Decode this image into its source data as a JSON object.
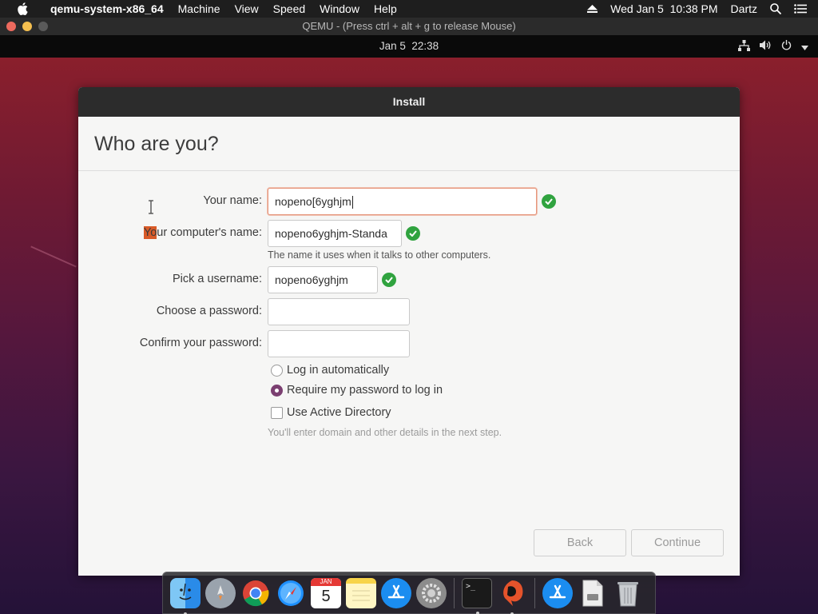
{
  "mac_menubar": {
    "app_name": "qemu-system-x86_64",
    "menus": [
      "Machine",
      "View",
      "Speed",
      "Window",
      "Help"
    ],
    "datetime": "Wed Jan 5  10:38 PM",
    "user": "Dartz"
  },
  "qemu_window": {
    "title": "QEMU - (Press ctrl + alt + g to release Mouse)"
  },
  "ubuntu_topbar": {
    "clock": "Jan 5  22:38"
  },
  "installer": {
    "window_title": "Install",
    "page_title": "Who are you?",
    "your_name": {
      "label": "Your name:",
      "value": "nopeno[6yghjm"
    },
    "computer_name": {
      "label_highlight": "Yo",
      "label_rest": "ur computer's name:",
      "value": "nopeno6yghjm-Standa",
      "hint": "The name it uses when it talks to other computers."
    },
    "username": {
      "label": "Pick a username:",
      "value": "nopeno6yghjm"
    },
    "password": {
      "label": "Choose a password:",
      "value": ""
    },
    "confirm_password": {
      "label": "Confirm your password:",
      "value": ""
    },
    "login_options": [
      {
        "label": "Log in automatically",
        "checked": false
      },
      {
        "label": "Require my password to log in",
        "checked": true
      }
    ],
    "active_directory": {
      "label": "Use Active Directory",
      "checked": false,
      "hint": "You'll enter domain and other details in the next step."
    },
    "back_button": "Back",
    "continue_button": "Continue"
  },
  "dock": {
    "apps": [
      "finder-icon",
      "launchpad-icon",
      "chrome-icon",
      "safari-icon",
      "calendar-icon",
      "notes-icon",
      "app-store-icon",
      "system-preferences-icon",
      "terminal-icon",
      "qemu-icon",
      "app-store-downloads-icon",
      "document-icon",
      "trash-icon"
    ],
    "calendar_month": "JAN",
    "calendar_day": "5",
    "terminal_prompt": ">_"
  },
  "colors": {
    "accent": "#7b3f71",
    "ok_green": "#30a33f",
    "focus_border": "#e5957b"
  }
}
